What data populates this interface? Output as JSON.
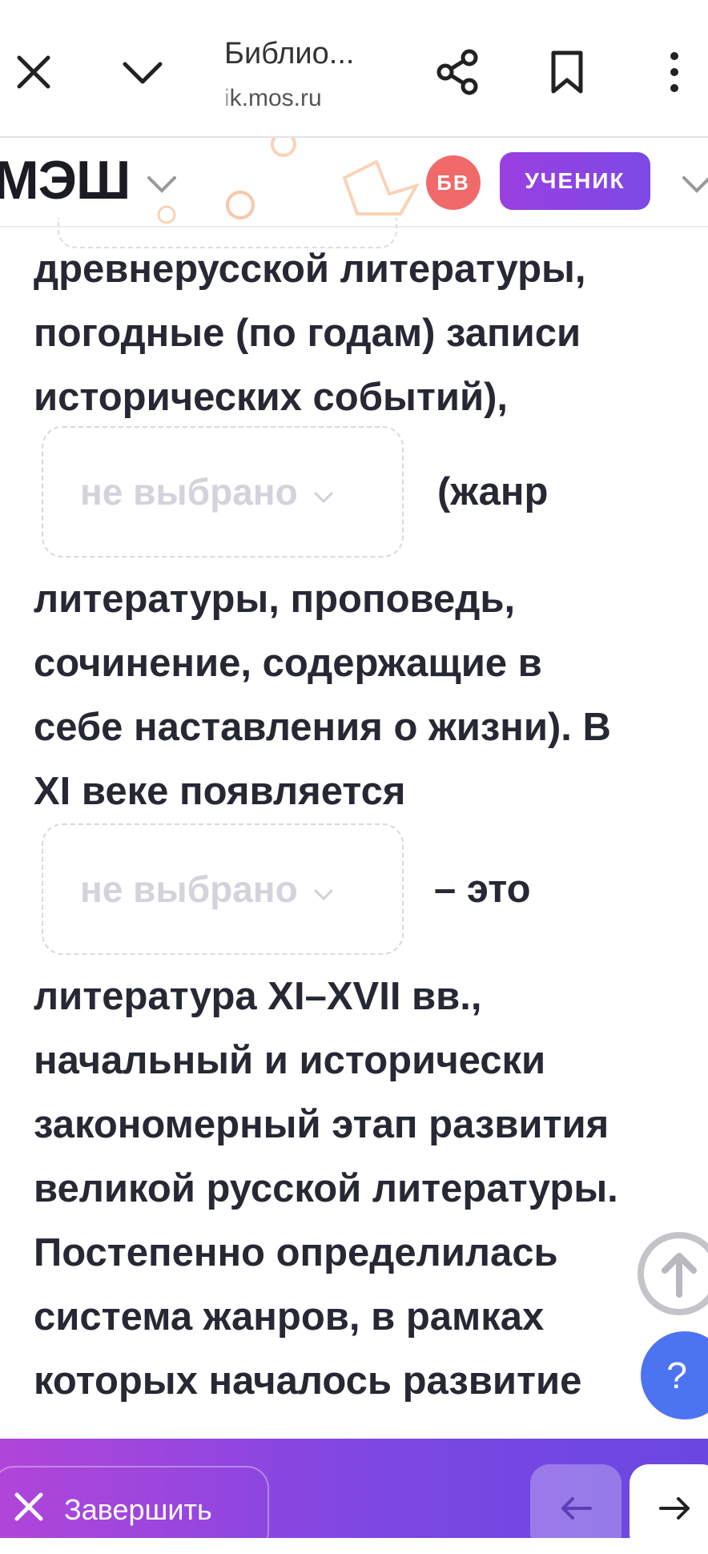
{
  "browser": {
    "title": "Библио...",
    "url_dim": "i",
    "url_main": "k.mos.ru"
  },
  "header": {
    "logo": "МЭШ",
    "avatar_initials": "БВ",
    "role": "УЧЕНИК"
  },
  "content": {
    "lines_1": [
      "древнерусской литературы,",
      "погодные (по годам) записи",
      "исторических событий),"
    ],
    "after_dropdown_1": "(жанр",
    "lines_2": [
      "литературы, проповедь,",
      "сочинение, содержащие в",
      "себе наставления о жизни). В",
      "XI веке появляется"
    ],
    "after_dropdown_2": "– это",
    "lines_3": [
      "литература XI–XVII вв.,",
      "начальный и исторически",
      "закономерный этап развития",
      "великой русской литературы.",
      "Постепенно определилась",
      "система жанров, в рамках",
      "которых началось развитие"
    ],
    "dropdown_1": "не выбрано",
    "dropdown_2": "не выбрано"
  },
  "help": {
    "label": "?"
  },
  "footer": {
    "finish_label": "Завершить"
  },
  "colors": {
    "accent_gradient_start": "#b145d9",
    "accent_gradient_end": "#6a47e0",
    "help_button": "#4d74f0",
    "avatar": "#f06a6a"
  }
}
